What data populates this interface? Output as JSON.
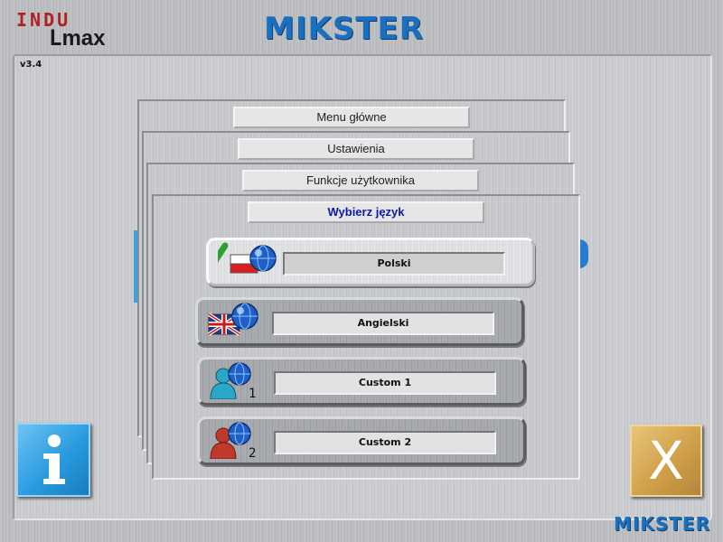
{
  "brand": {
    "indu_text": "INDU",
    "lmax_text": "max",
    "mikster_top": "MIKSTER",
    "mikster_bottom": "MIKSTER"
  },
  "version": "v3.4",
  "panels": [
    {
      "title": "Menu główne"
    },
    {
      "title": "Ustawienia"
    },
    {
      "title": "Funkcje użytkownika"
    },
    {
      "title": "Wybierz język"
    }
  ],
  "languages": [
    {
      "label": "Polski",
      "icon": "flag-poland-globe-icon",
      "selected": true
    },
    {
      "label": "Angielski",
      "icon": "flag-uk-globe-icon",
      "selected": false
    },
    {
      "label": "Custom 1",
      "icon": "user-globe-1-icon",
      "selected": false
    },
    {
      "label": "Custom 2",
      "icon": "user-globe-2-icon",
      "selected": false
    }
  ],
  "buttons": {
    "info_icon": "info-icon",
    "close_glyph": "X"
  },
  "colors": {
    "accent_blue": "#1a6fbf",
    "title_blue": "#0a1aa8",
    "info_blue": "#2a9bdf",
    "close_gold": "#d0a04a",
    "check_green": "#2fa02f"
  }
}
